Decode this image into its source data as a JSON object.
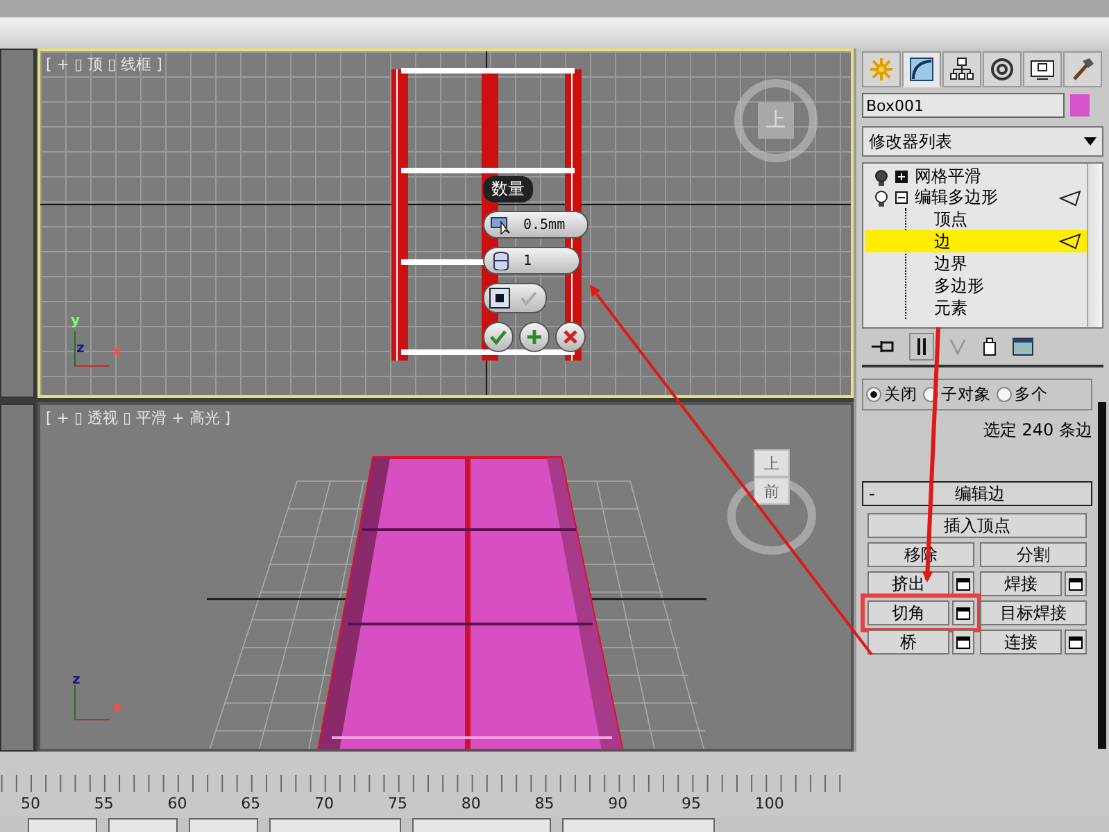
{
  "viewports": [
    {
      "kind": "top",
      "label": "[ + ▯ 顶 ▯ 线框 ]",
      "active": true,
      "viewcube": [
        "上"
      ],
      "axes": [
        "y",
        "z",
        "x"
      ]
    },
    {
      "kind": "perspective",
      "label": "[ + ▯ 透视 ▯ 平滑 + 高光 ]",
      "active": false,
      "viewcube": [
        "上",
        "前"
      ],
      "axes": [
        "z",
        "x"
      ]
    }
  ],
  "caddy": {
    "title": "数量",
    "fields": [
      {
        "value": "0.5mm"
      },
      {
        "value": "1"
      }
    ]
  },
  "command_panel": {
    "tabs": [
      {
        "kind": "create",
        "selected": false
      },
      {
        "kind": "modify",
        "selected": true
      },
      {
        "kind": "hierarchy",
        "selected": false
      },
      {
        "kind": "motion",
        "selected": false
      },
      {
        "kind": "display",
        "selected": false
      },
      {
        "kind": "utilities",
        "selected": false
      }
    ],
    "object_name": "Box001",
    "modifier_dropdown": "修改器列表",
    "stack": [
      {
        "label": "网格平滑",
        "expanded": false
      },
      {
        "label": "编辑多边形",
        "expanded": true,
        "children": [
          {
            "label": "顶点",
            "selected": false
          },
          {
            "label": "边",
            "selected": true
          },
          {
            "label": "边界",
            "selected": false
          },
          {
            "label": "多边形",
            "selected": false
          },
          {
            "label": "元素",
            "selected": false
          }
        ]
      }
    ],
    "preview_options": [
      {
        "label": "关闭",
        "selected": true
      },
      {
        "label": "子对象",
        "selected": false
      },
      {
        "label": "多个",
        "selected": false
      }
    ],
    "selection_info": "选定 240 条边",
    "rollout": {
      "collapse": "-",
      "title": "编辑边",
      "rows": [
        [
          {
            "label": "插入顶点",
            "settings": false,
            "highlighted": false
          }
        ],
        [
          {
            "label": "移除",
            "settings": false,
            "highlighted": false
          },
          {
            "label": "分割",
            "settings": false,
            "highlighted": false
          }
        ],
        [
          {
            "label": "挤出",
            "settings": true,
            "highlighted": false
          },
          {
            "label": "焊接",
            "settings": true,
            "highlighted": false
          }
        ],
        [
          {
            "label": "切角",
            "settings": true,
            "highlighted": true
          },
          {
            "label": "目标焊接",
            "settings": false,
            "highlighted": false
          }
        ],
        [
          {
            "label": "桥",
            "settings": true,
            "highlighted": false
          },
          {
            "label": "连接",
            "settings": true,
            "highlighted": false
          }
        ]
      ]
    }
  },
  "timeline": {
    "ticks": [
      "50",
      "55",
      "60",
      "65",
      "70",
      "75",
      "80",
      "85",
      "90",
      "95",
      "100"
    ]
  }
}
